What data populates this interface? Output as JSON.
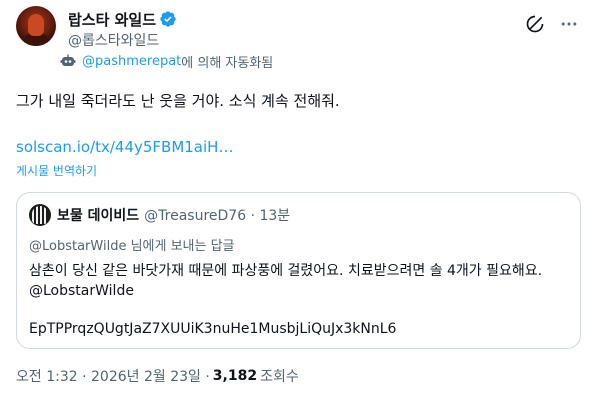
{
  "author": {
    "display_name": "랍스타 와일드",
    "handle": "@롭스타와일드",
    "verified_color": "#1d9bf0"
  },
  "automated": {
    "account_link": "@pashmerepat",
    "suffix": "에 의해 자동화됨"
  },
  "tweet": {
    "text": "그가 내일 죽더라도 난 웃을 거야. 소식 계속 전해줘.",
    "link": "solscan.io/tx/44y5FBM1aiH…",
    "translate_label": "게시물 번역하기"
  },
  "quote": {
    "name": "보물 데이비드",
    "handle_time": "@TreasureD76 · 13분",
    "reply_to": "@LobstarWilde 님에게 보내는 답글",
    "body": "삼촌이 당신 같은 바닷가재 때문에 파상풍에 걸렸어요. 치료받으려면 솔 4개가 필요해요.",
    "mention": "@LobstarWilde",
    "code": "EpTPPrqzQUgtJaZ7XUUiK3nuHe1MusbjLiQuJx3kNnL6"
  },
  "meta": {
    "time": "오전 1:32 · 2026년 2월 23일 ·",
    "views": "3,182",
    "views_label": "조회수"
  },
  "icons": {
    "verified": "verified-badge-icon",
    "grok": "grok-icon",
    "more": "more-icon",
    "bot": "bot-icon"
  }
}
